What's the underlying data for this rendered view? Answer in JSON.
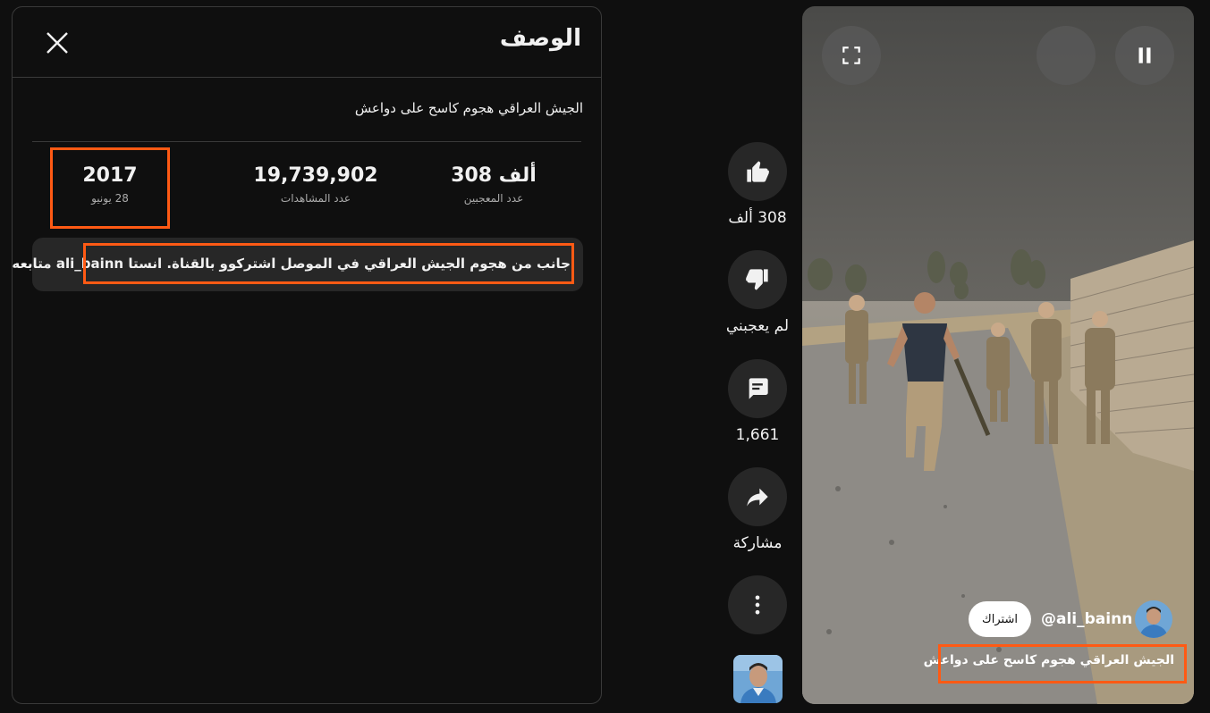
{
  "description_panel": {
    "heading": "الوصف",
    "video_title": "الجيش العراقي هجوم كاسح على دواعش",
    "stats": {
      "likes_value": "308 ألف",
      "likes_label": "عدد المعجبين",
      "views_value": "19,739,902",
      "views_label": "عدد المشاهدات",
      "year": "2017",
      "date": "28 يونيو"
    },
    "description_text": "جانب من هجوم الجيش العراقي في الموصل اشتركوو بالقناة. انستا ali_bainn متابعه"
  },
  "actions": {
    "like_label": "308 ألف",
    "dislike_label": "لم يعجبني",
    "comments_label": "1,661",
    "share_label": "مشاركة"
  },
  "video": {
    "channel_handle": "@ali_bainn",
    "subscribe_label": "اشتراك",
    "title": "الجيش العراقي هجوم كاسح على دواعش"
  },
  "colors": {
    "highlight": "#ff5a14",
    "background": "#0f0f0f",
    "button_bg": "#272727"
  }
}
